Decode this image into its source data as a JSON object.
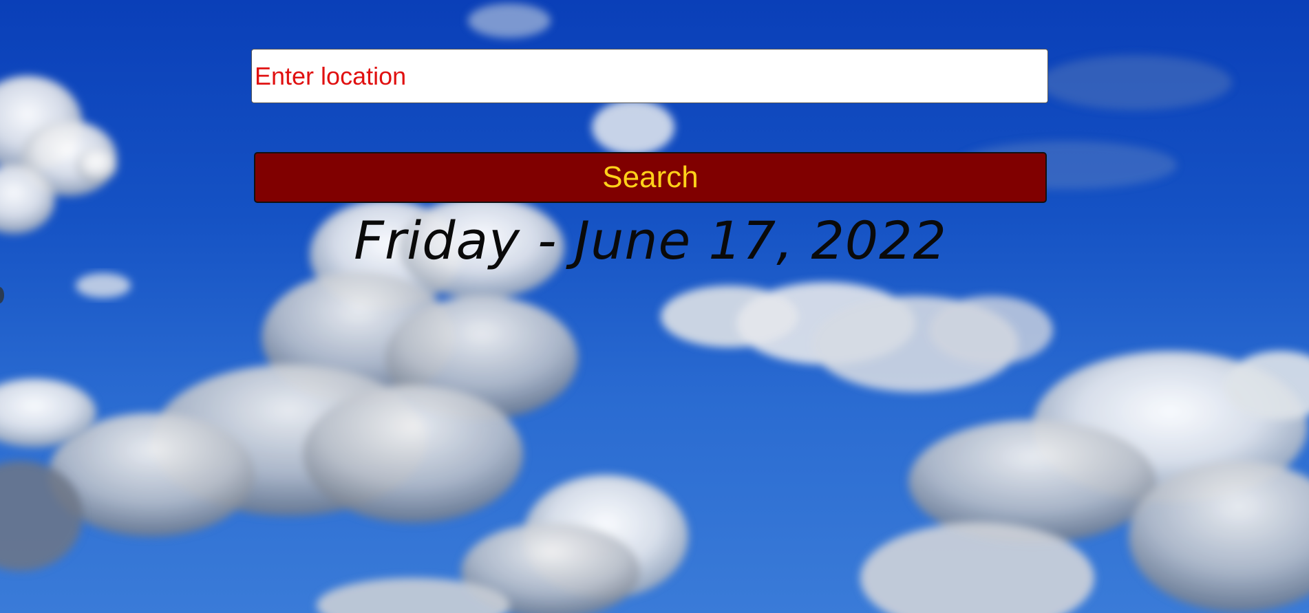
{
  "search": {
    "placeholder": "Enter location",
    "value": "",
    "placeholder_color": "#e01010"
  },
  "button": {
    "label": "Search",
    "background": "#800000",
    "text_color": "#ffd21a"
  },
  "date": {
    "label": "Friday - June 17, 2022"
  },
  "background": {
    "type": "sky-with-clouds",
    "sky_color": "#1552c4"
  }
}
